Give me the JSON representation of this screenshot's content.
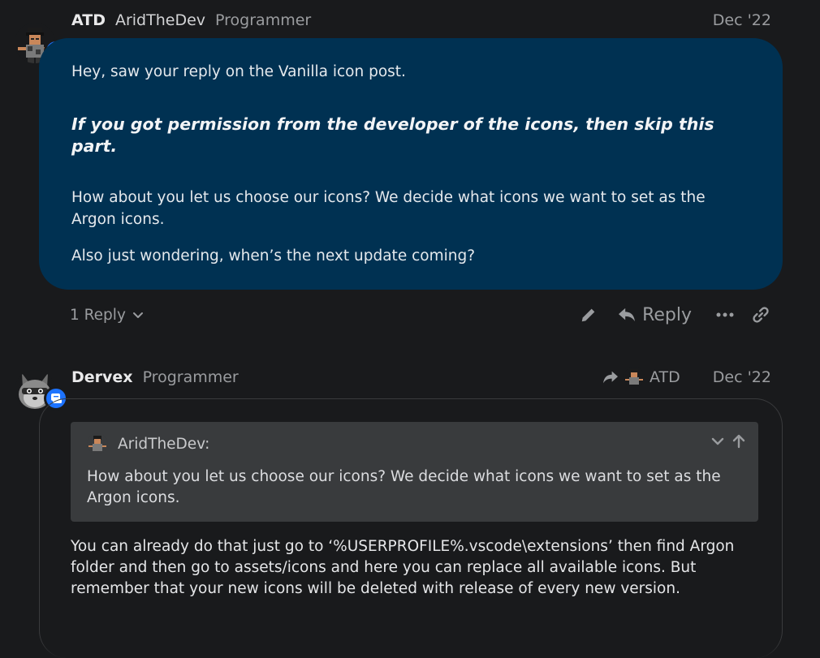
{
  "post1": {
    "author_name": "ATD",
    "username": "AridTheDev",
    "user_title": "Programmer",
    "date": "Dec '22",
    "body": {
      "lead": "Hey, saw your reply on the Vanilla icon post.",
      "emphasis": "If you got permission from the developer of the icons, then skip this part.",
      "para1": "How about you let us choose our icons? We decide what icons we want to set as the Argon icons.",
      "para2": "Also just wondering, when’s the next update coming?"
    },
    "actions": {
      "reply_count_label": "1 Reply",
      "reply_label": "Reply"
    }
  },
  "post2": {
    "author_name": "Dervex",
    "user_title": "Programmer",
    "reply_to_name": "ATD",
    "date": "Dec '22",
    "quote": {
      "author": "AridTheDev:",
      "text": "How about you let us choose our icons? We decide what icons we want to set as the Argon icons."
    },
    "body": "You can already do that just go to ‘%USERPROFILE%.vscode\\extensions’ then find Argon folder and then go to assets/icons and here you can replace all available icons. But remember that your new icons will be deleted with release of every new version."
  },
  "colors": {
    "page_bg": "#191a1c",
    "bubble_bg": "#003152",
    "quote_bg": "#393b3d",
    "badge_blue": "#1d73ff",
    "muted_text": "#9a9c9f"
  },
  "icons": {
    "role_badge": "scroll-icon",
    "edit": "pencil-icon",
    "reply": "reply-arrow-icon",
    "more": "ellipsis-icon",
    "link": "link-icon",
    "reply_to": "share-arrow-icon",
    "expand": "chevron-down-icon",
    "jump": "arrow-up-icon"
  }
}
